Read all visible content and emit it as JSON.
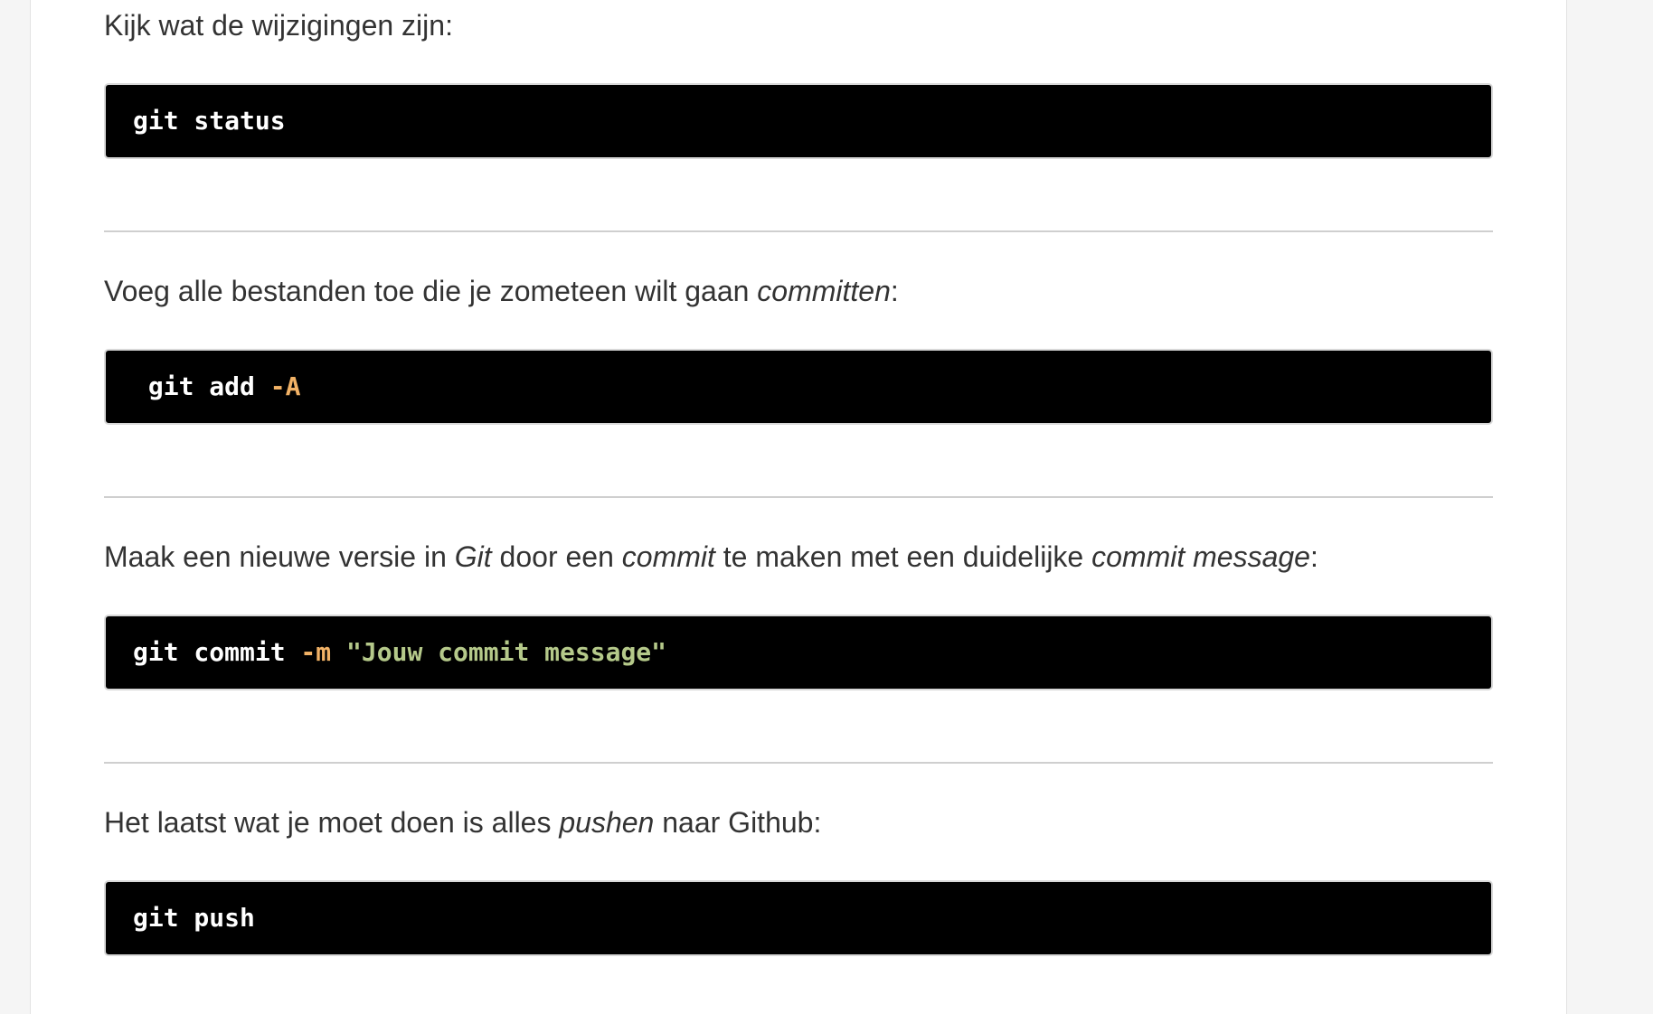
{
  "steps": [
    {
      "prose": {
        "text_before": "Kijk wat de wijzigingen zijn:"
      },
      "code": {
        "cmd": "git status"
      }
    },
    {
      "prose": {
        "text_before": "Voeg alle bestanden toe die je zometeen wilt gaan ",
        "em1": "committen",
        "text_after": ":"
      },
      "code": {
        "cmd": " git add",
        "flag": " -A"
      }
    },
    {
      "prose": {
        "text_before": "Maak een nieuwe versie in ",
        "em1": "Git",
        "text_mid1": " door een ",
        "em2": "commit",
        "text_mid2": " te maken met een duidelijke ",
        "em3": "commit message",
        "text_after": ":"
      },
      "code": {
        "cmd": "git commit",
        "flag": " -m",
        "string": " \"Jouw commit message\""
      }
    },
    {
      "prose": {
        "text_before": "Het laatst wat je moet doen is alles ",
        "em1": "pushen",
        "text_after": " naar Github:"
      },
      "code": {
        "cmd": "git push"
      }
    }
  ],
  "theme": {
    "page_background": "#f5f5f5",
    "content_background": "#ffffff",
    "code_background": "#000000",
    "code_text": "#ffffff",
    "flag_color": "#f2b266",
    "string_color": "#b5c98a",
    "divider_color": "#cfcfcf"
  }
}
